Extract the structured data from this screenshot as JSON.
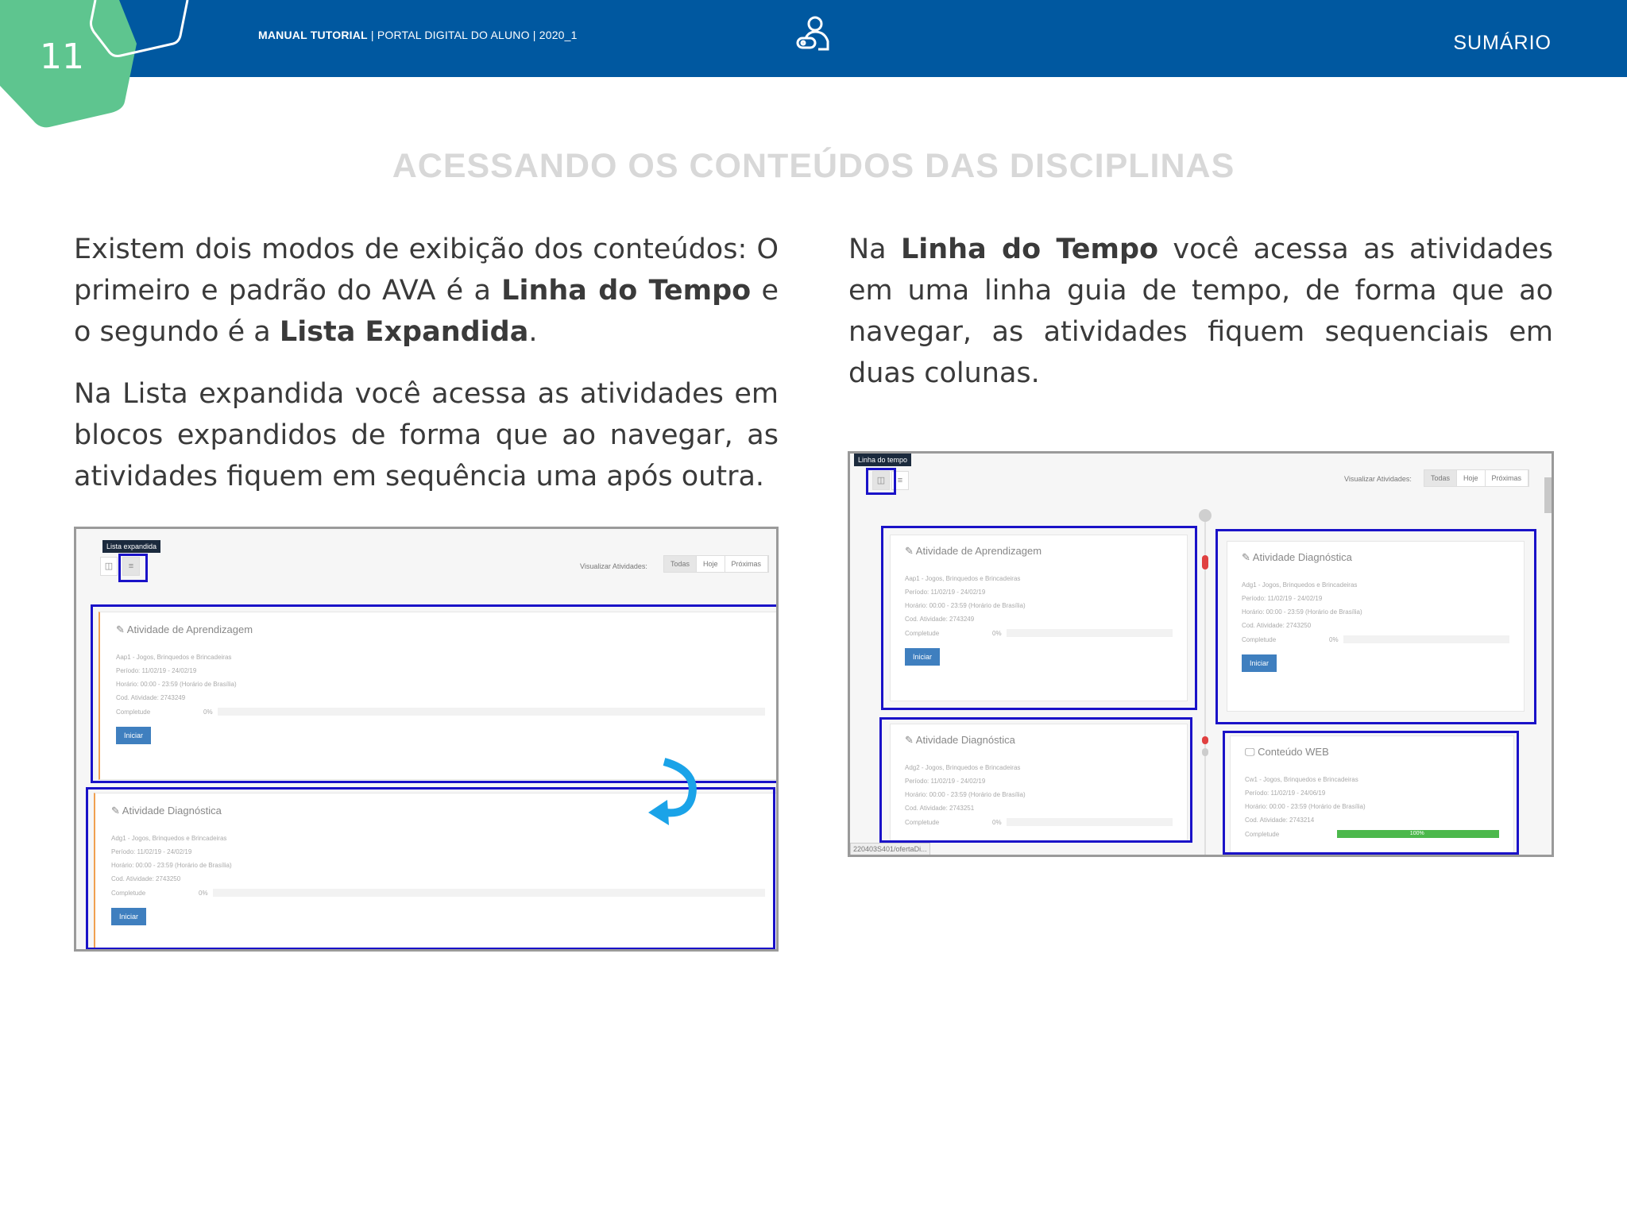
{
  "header": {
    "page_number": "11",
    "manual": "MANUAL TUTORIAL",
    "portal": "PORTAL DIGITAL DO ALUNO",
    "period": "2020_1",
    "summary_link": "SUMÁRIO",
    "icon": "user-key-icon",
    "bg_color": "#0058a0",
    "accent_color": "#5ec58f"
  },
  "title": "ACESSANDO OS CONTEÚDOS DAS DISCIPLINAS",
  "left_text": {
    "p1": {
      "a": "Existem dois modos de exibição dos conteúdos: O primeiro e padrão do AVA é a ",
      "b1": "Linha do Tempo",
      "c": " e o segundo é a ",
      "b2": "Lista Expandida",
      "d": "."
    },
    "p2": "Na Lista expandida você acessa as atividades em blocos expandidos de forma que ao navegar, as atividades fiquem em sequência uma após outra."
  },
  "right_text": {
    "a": "Na ",
    "b": "Linha do Tempo",
    "c": " você acessa as atividades em uma linha guia de tempo, de forma que ao navegar, as atividades fiquem sequenciais em duas colunas."
  },
  "mock_list": {
    "tooltip": "Lista expandida",
    "view_label": "Visualizar Atividades:",
    "tabs": [
      "Todas",
      "Hoje",
      "Próximas"
    ],
    "cards": [
      {
        "title": "Atividade de Aprendizagem",
        "lines": [
          "Aap1 - Jogos, Brinquedos e Brincadeiras",
          "Período: 11/02/19 - 24/02/19",
          "Horário: 00:00 - 23:59 (Horário de Brasília)",
          "Cod. Atividade: 2743249"
        ],
        "completion_label": "Completude",
        "completion": "0%",
        "button": "Iniciar"
      },
      {
        "title": "Atividade Diagnóstica",
        "lines": [
          "Adg1 - Jogos, Brinquedos e Brincadeiras",
          "Período: 11/02/19 - 24/02/19",
          "Horário: 00:00 - 23:59 (Horário de Brasília)",
          "Cod. Atividade: 2743250"
        ],
        "completion_label": "Completude",
        "completion": "0%",
        "button": "Iniciar"
      }
    ]
  },
  "mock_timeline": {
    "tooltip": "Linha do tempo",
    "view_label": "Visualizar Atividades:",
    "tabs": [
      "Todas",
      "Hoje",
      "Próximas"
    ],
    "status_url": "220403S401/ofertaDi...",
    "cards": [
      {
        "title": "Atividade de Aprendizagem",
        "lines": [
          "Aap1 - Jogos, Brinquedos e Brincadeiras",
          "Período: 11/02/19 - 24/02/19",
          "Horário: 00:00 - 23:59 (Horário de Brasília)",
          "Cod. Atividade: 2743249"
        ],
        "completion_label": "Completude",
        "completion": "0%",
        "button": "Iniciar"
      },
      {
        "title": "Atividade Diagnóstica",
        "lines": [
          "Adg1 - Jogos, Brinquedos e Brincadeiras",
          "Período: 11/02/19 - 24/02/19",
          "Horário: 00:00 - 23:59 (Horário de Brasília)",
          "Cod. Atividade: 2743250"
        ],
        "completion_label": "Completude",
        "completion": "0%",
        "button": "Iniciar"
      },
      {
        "title": "Atividade Diagnóstica",
        "lines": [
          "Adg2 - Jogos, Brinquedos e Brincadeiras",
          "Período: 11/02/19 - 24/02/19",
          "Horário: 00:00 - 23:59 (Horário de Brasília)",
          "Cod. Atividade: 2743251"
        ],
        "completion_label": "Completude",
        "completion": "0%"
      },
      {
        "title": "Conteúdo WEB",
        "lines": [
          "Cw1 - Jogos, Brinquedos e Brincadeiras",
          "Período: 11/02/19 - 24/06/19",
          "Horário: 00:00 - 23:59 (Horário de Brasília)",
          "Cod. Atividade: 2743214"
        ],
        "completion_label": "Completude",
        "completion": "100%",
        "completion_value": 100
      }
    ]
  }
}
